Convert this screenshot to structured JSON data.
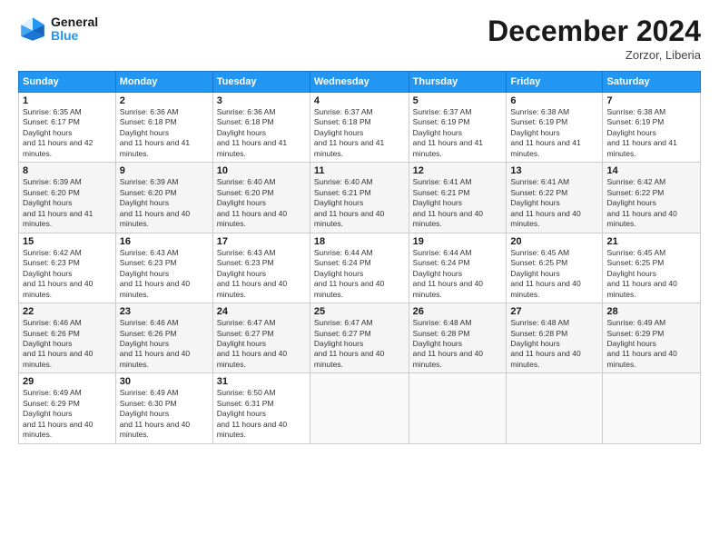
{
  "header": {
    "logo_line1": "General",
    "logo_line2": "Blue",
    "month_title": "December 2024",
    "location": "Zorzor, Liberia"
  },
  "days_of_week": [
    "Sunday",
    "Monday",
    "Tuesday",
    "Wednesday",
    "Thursday",
    "Friday",
    "Saturday"
  ],
  "weeks": [
    [
      {
        "day": "1",
        "sunrise": "6:35 AM",
        "sunset": "6:17 PM",
        "daylight": "11 hours and 42 minutes."
      },
      {
        "day": "2",
        "sunrise": "6:36 AM",
        "sunset": "6:18 PM",
        "daylight": "11 hours and 41 minutes."
      },
      {
        "day": "3",
        "sunrise": "6:36 AM",
        "sunset": "6:18 PM",
        "daylight": "11 hours and 41 minutes."
      },
      {
        "day": "4",
        "sunrise": "6:37 AM",
        "sunset": "6:18 PM",
        "daylight": "11 hours and 41 minutes."
      },
      {
        "day": "5",
        "sunrise": "6:37 AM",
        "sunset": "6:19 PM",
        "daylight": "11 hours and 41 minutes."
      },
      {
        "day": "6",
        "sunrise": "6:38 AM",
        "sunset": "6:19 PM",
        "daylight": "11 hours and 41 minutes."
      },
      {
        "day": "7",
        "sunrise": "6:38 AM",
        "sunset": "6:19 PM",
        "daylight": "11 hours and 41 minutes."
      }
    ],
    [
      {
        "day": "8",
        "sunrise": "6:39 AM",
        "sunset": "6:20 PM",
        "daylight": "11 hours and 41 minutes."
      },
      {
        "day": "9",
        "sunrise": "6:39 AM",
        "sunset": "6:20 PM",
        "daylight": "11 hours and 40 minutes."
      },
      {
        "day": "10",
        "sunrise": "6:40 AM",
        "sunset": "6:20 PM",
        "daylight": "11 hours and 40 minutes."
      },
      {
        "day": "11",
        "sunrise": "6:40 AM",
        "sunset": "6:21 PM",
        "daylight": "11 hours and 40 minutes."
      },
      {
        "day": "12",
        "sunrise": "6:41 AM",
        "sunset": "6:21 PM",
        "daylight": "11 hours and 40 minutes."
      },
      {
        "day": "13",
        "sunrise": "6:41 AM",
        "sunset": "6:22 PM",
        "daylight": "11 hours and 40 minutes."
      },
      {
        "day": "14",
        "sunrise": "6:42 AM",
        "sunset": "6:22 PM",
        "daylight": "11 hours and 40 minutes."
      }
    ],
    [
      {
        "day": "15",
        "sunrise": "6:42 AM",
        "sunset": "6:23 PM",
        "daylight": "11 hours and 40 minutes."
      },
      {
        "day": "16",
        "sunrise": "6:43 AM",
        "sunset": "6:23 PM",
        "daylight": "11 hours and 40 minutes."
      },
      {
        "day": "17",
        "sunrise": "6:43 AM",
        "sunset": "6:23 PM",
        "daylight": "11 hours and 40 minutes."
      },
      {
        "day": "18",
        "sunrise": "6:44 AM",
        "sunset": "6:24 PM",
        "daylight": "11 hours and 40 minutes."
      },
      {
        "day": "19",
        "sunrise": "6:44 AM",
        "sunset": "6:24 PM",
        "daylight": "11 hours and 40 minutes."
      },
      {
        "day": "20",
        "sunrise": "6:45 AM",
        "sunset": "6:25 PM",
        "daylight": "11 hours and 40 minutes."
      },
      {
        "day": "21",
        "sunrise": "6:45 AM",
        "sunset": "6:25 PM",
        "daylight": "11 hours and 40 minutes."
      }
    ],
    [
      {
        "day": "22",
        "sunrise": "6:46 AM",
        "sunset": "6:26 PM",
        "daylight": "11 hours and 40 minutes."
      },
      {
        "day": "23",
        "sunrise": "6:46 AM",
        "sunset": "6:26 PM",
        "daylight": "11 hours and 40 minutes."
      },
      {
        "day": "24",
        "sunrise": "6:47 AM",
        "sunset": "6:27 PM",
        "daylight": "11 hours and 40 minutes."
      },
      {
        "day": "25",
        "sunrise": "6:47 AM",
        "sunset": "6:27 PM",
        "daylight": "11 hours and 40 minutes."
      },
      {
        "day": "26",
        "sunrise": "6:48 AM",
        "sunset": "6:28 PM",
        "daylight": "11 hours and 40 minutes."
      },
      {
        "day": "27",
        "sunrise": "6:48 AM",
        "sunset": "6:28 PM",
        "daylight": "11 hours and 40 minutes."
      },
      {
        "day": "28",
        "sunrise": "6:49 AM",
        "sunset": "6:29 PM",
        "daylight": "11 hours and 40 minutes."
      }
    ],
    [
      {
        "day": "29",
        "sunrise": "6:49 AM",
        "sunset": "6:29 PM",
        "daylight": "11 hours and 40 minutes."
      },
      {
        "day": "30",
        "sunrise": "6:49 AM",
        "sunset": "6:30 PM",
        "daylight": "11 hours and 40 minutes."
      },
      {
        "day": "31",
        "sunrise": "6:50 AM",
        "sunset": "6:31 PM",
        "daylight": "11 hours and 40 minutes."
      },
      null,
      null,
      null,
      null
    ]
  ]
}
